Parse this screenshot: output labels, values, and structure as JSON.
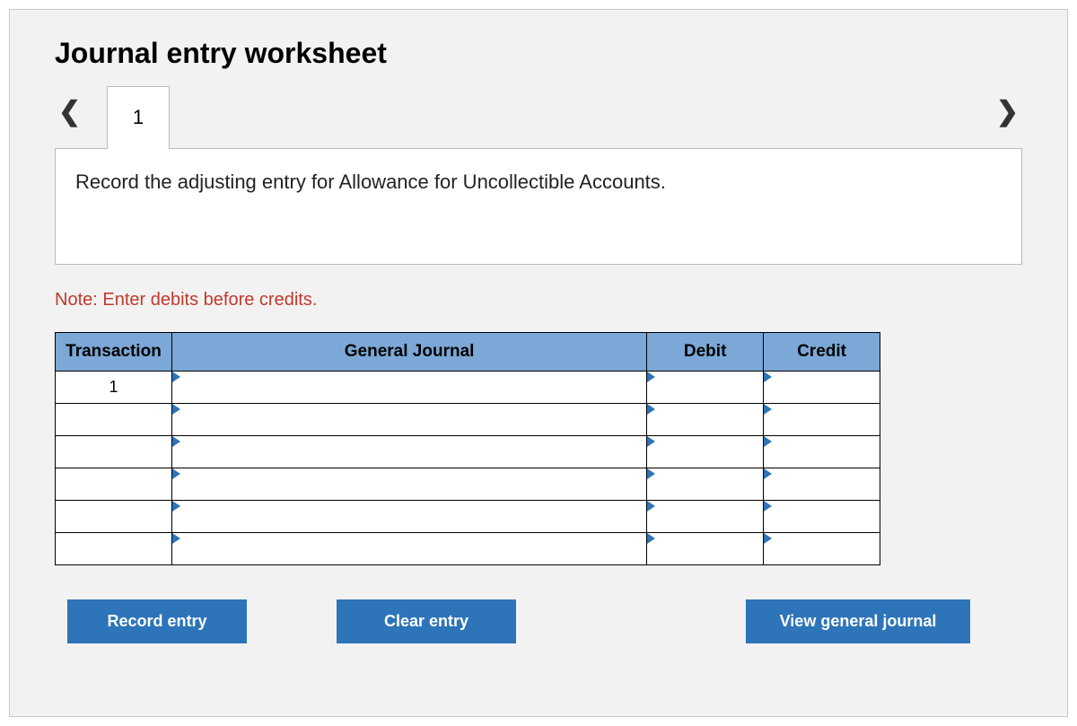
{
  "title": "Journal entry worksheet",
  "tab_label": "1",
  "instruction": "Record the adjusting entry for Allowance for Uncollectible Accounts.",
  "note": "Note: Enter debits before credits.",
  "headers": {
    "transaction": "Transaction",
    "general_journal": "General Journal",
    "debit": "Debit",
    "credit": "Credit"
  },
  "rows": [
    {
      "transaction": "1",
      "general_journal": "",
      "debit": "",
      "credit": ""
    },
    {
      "transaction": "",
      "general_journal": "",
      "debit": "",
      "credit": ""
    },
    {
      "transaction": "",
      "general_journal": "",
      "debit": "",
      "credit": ""
    },
    {
      "transaction": "",
      "general_journal": "",
      "debit": "",
      "credit": ""
    },
    {
      "transaction": "",
      "general_journal": "",
      "debit": "",
      "credit": ""
    },
    {
      "transaction": "",
      "general_journal": "",
      "debit": "",
      "credit": ""
    }
  ],
  "buttons": {
    "record": "Record entry",
    "clear": "Clear entry",
    "view": "View general journal"
  }
}
